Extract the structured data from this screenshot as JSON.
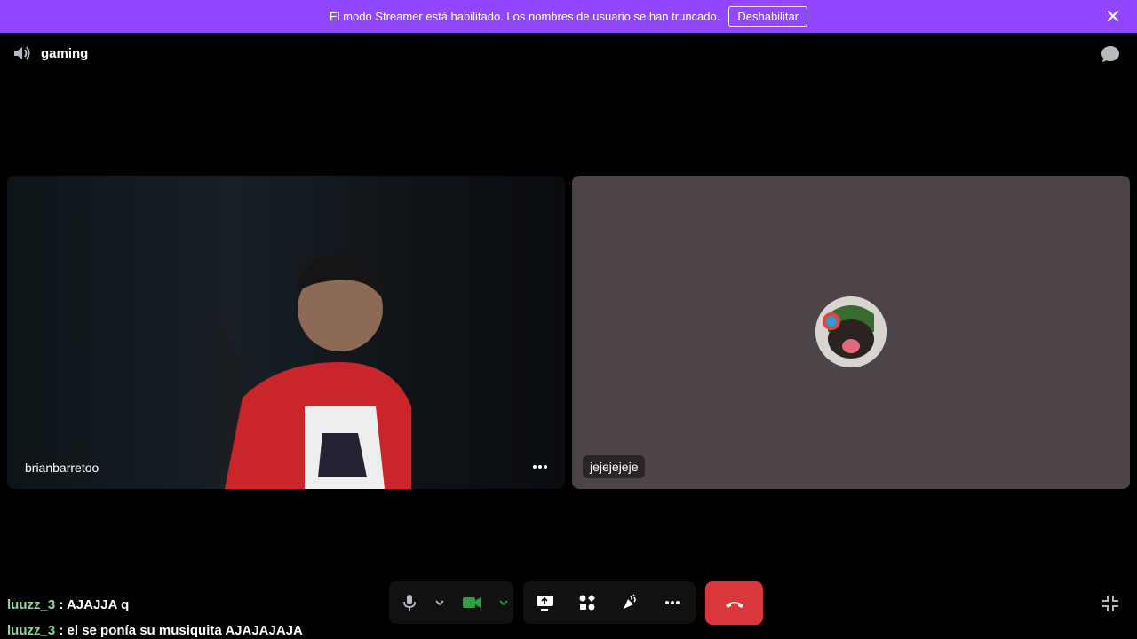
{
  "banner": {
    "message": "El modo Streamer está habilitado. Los nombres de usuario se han truncado.",
    "button_label": "Deshabilitar",
    "color": "#9146ff"
  },
  "header": {
    "channel_name": "gaming"
  },
  "tiles": {
    "left": {
      "username": "brianbarretoo"
    },
    "right": {
      "username": "jejejejeje",
      "background": "#4c4448"
    }
  },
  "chat": {
    "messages": [
      {
        "user": "luuzz_3",
        "text": " : AJAJJA q"
      },
      {
        "user": "luuzz_3",
        "text": " : el se ponía su musiquita AJAJAJAJA"
      }
    ]
  },
  "icons": {
    "speaker": "speaker-icon",
    "chat": "chat-bubble-icon",
    "close": "close-icon",
    "mic": "microphone-icon",
    "camera": "camera-icon",
    "screen_share": "screen-share-icon",
    "activities": "activities-icon",
    "soundboard": "soundboard-icon",
    "more": "more-icon",
    "hangup": "hangup-icon",
    "collapse": "collapse-icon"
  },
  "colors": {
    "hangup": "#da373c",
    "camera_active": "#2ea043",
    "chat_user": "#8fd6a2"
  }
}
